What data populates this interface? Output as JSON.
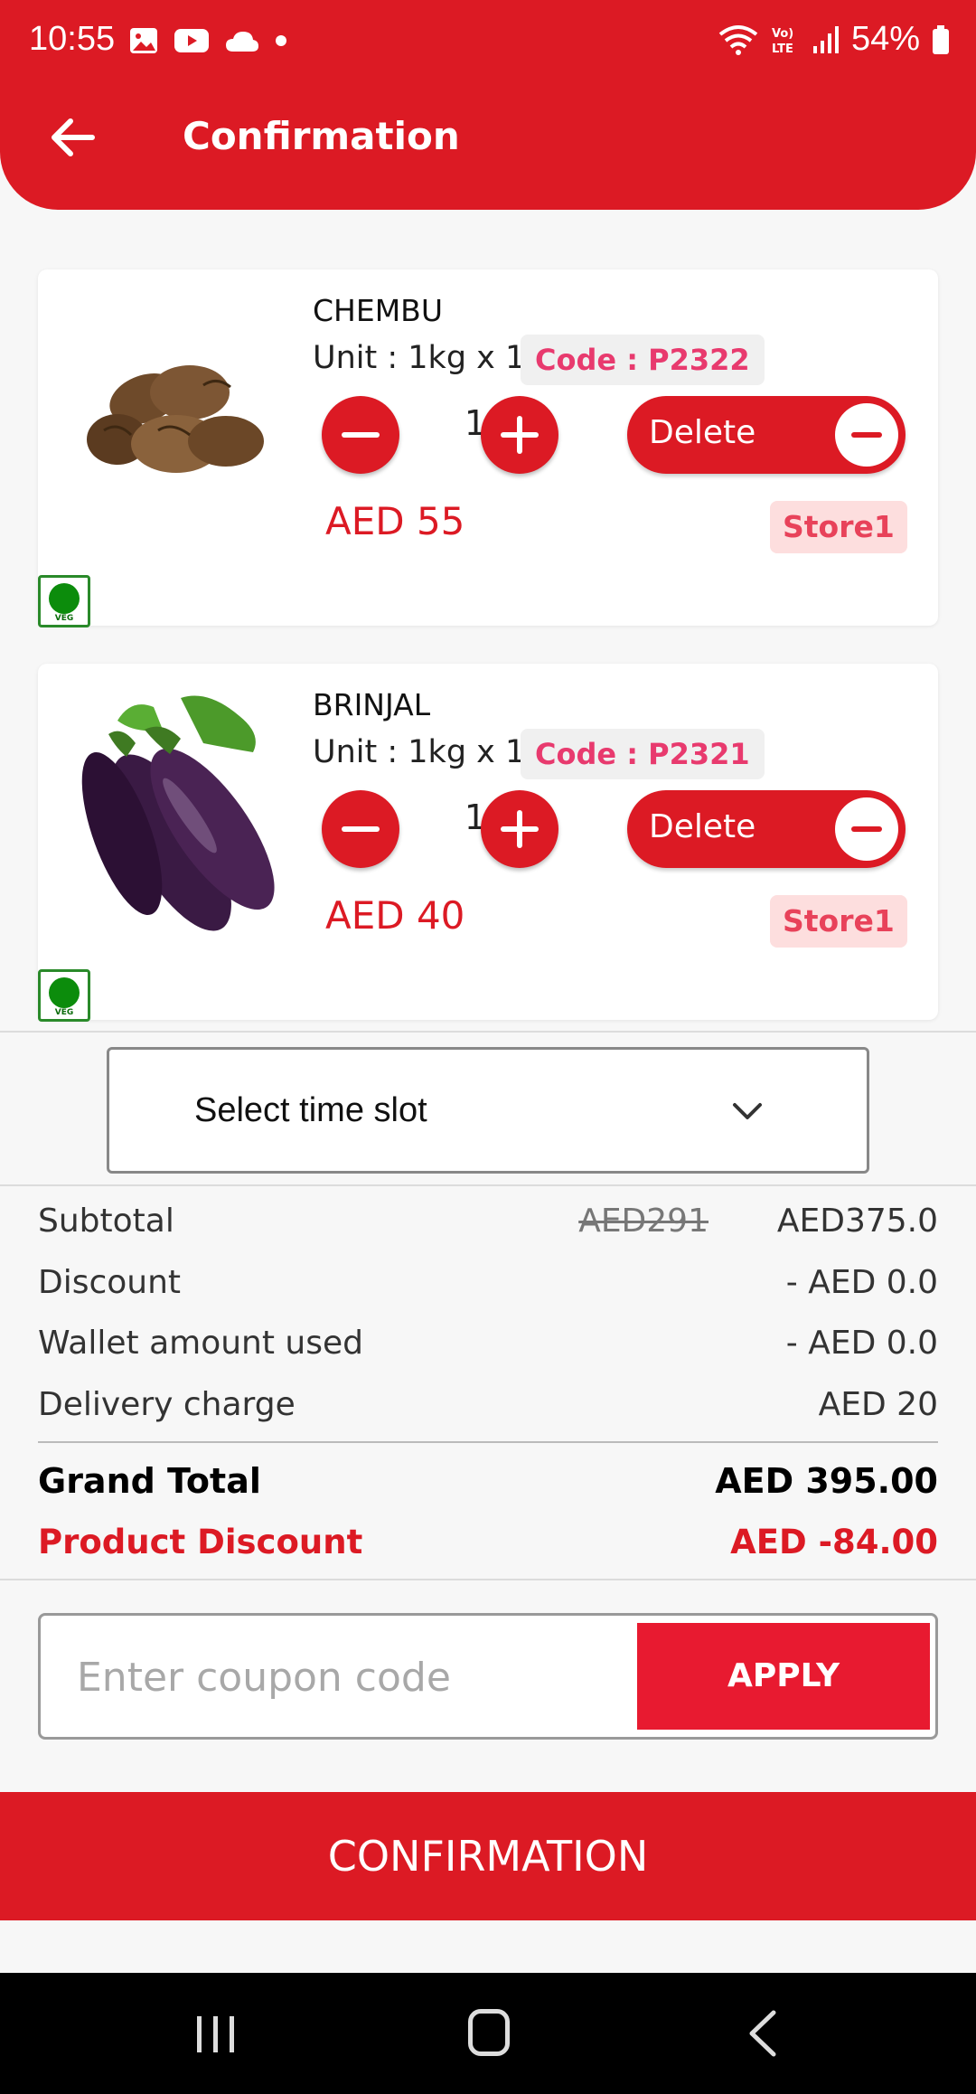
{
  "status_bar": {
    "time": "10:55",
    "battery": "54%"
  },
  "header": {
    "title": "Confirmation"
  },
  "products": [
    {
      "name": "CHEMBU",
      "unit": "Unit : 1kg x 1",
      "code": "Code : P2322",
      "quantity": "1",
      "delete_label": "Delete",
      "price": "AED 55",
      "store": "Store1",
      "veg_label": "VEG",
      "image_icon": "taro-root-image"
    },
    {
      "name": "BRINJAL",
      "unit": "Unit : 1kg x 1",
      "code": "Code : P2321",
      "quantity": "1",
      "delete_label": "Delete",
      "price": "AED 40",
      "store": "Store1",
      "veg_label": "VEG",
      "image_icon": "eggplant-image"
    }
  ],
  "time_slot": {
    "label": "Select time slot"
  },
  "summary": {
    "subtotal_label": "Subtotal",
    "subtotal_strike": "AED291",
    "subtotal_value": "AED375.0",
    "discount_label": "Discount",
    "discount_value": "- AED 0.0",
    "wallet_label": "Wallet amount used",
    "wallet_value": "- AED 0.0",
    "delivery_label": "Delivery charge",
    "delivery_value": "AED 20",
    "grand_total_label": "Grand Total",
    "grand_total_value": "AED 395.00",
    "product_discount_label": "Product Discount",
    "product_discount_value": "AED -84.00"
  },
  "coupon": {
    "placeholder": "Enter coupon code",
    "apply_label": "APPLY"
  },
  "confirm_label": "CONFIRMATION",
  "colors": {
    "primary": "#dc1a24",
    "code_text": "#e83a6e",
    "store_bg": "#fddede",
    "veg_green": "#0c8c0c"
  }
}
